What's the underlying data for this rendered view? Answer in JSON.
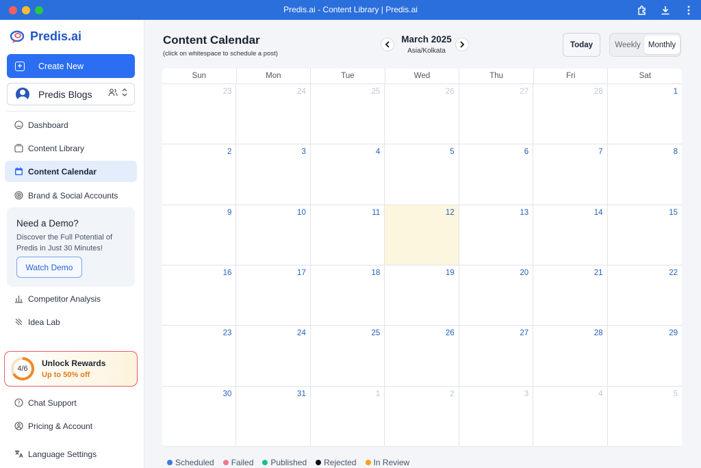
{
  "window": {
    "title": "Predis.ai - Content Library | Predis.ai"
  },
  "sidebar": {
    "brand": "Predis.ai",
    "create_label": "Create New",
    "workspace_name": "Predis Blogs",
    "nav_top": [
      {
        "label": "Dashboard",
        "icon": "dashboard-icon"
      },
      {
        "label": "Content Library",
        "icon": "library-icon"
      },
      {
        "label": "Content Calendar",
        "icon": "calendar-icon",
        "active": true
      },
      {
        "label": "Brand & Social Accounts",
        "icon": "fingerprint-icon"
      }
    ],
    "demo": {
      "title": "Need a Demo?",
      "text": "Discover the Full Potential of Predis in Just 30 Minutes!",
      "button": "Watch Demo"
    },
    "nav_mid": [
      {
        "label": "Competitor Analysis",
        "icon": "bar-chart-icon"
      },
      {
        "label": "Idea Lab",
        "icon": "sparkle-icon"
      }
    ],
    "rewards": {
      "progress": "4/6",
      "progress_fraction": 0.667,
      "title": "Unlock Rewards",
      "subtitle": "Up to 50% off"
    },
    "nav_bottom": [
      {
        "label": "Chat Support",
        "icon": "help-icon"
      },
      {
        "label": "Pricing & Account",
        "icon": "account-icon"
      },
      {
        "label": "Language Settings",
        "icon": "translate-icon"
      }
    ]
  },
  "main": {
    "title": "Content Calendar",
    "subtitle": "(click on whitespace to schedule a post)",
    "month": "March 2025",
    "timezone": "Asia/Kolkata",
    "today_label": "Today",
    "view_weekly": "Weekly",
    "view_monthly": "Monthly",
    "weekdays": [
      "Sun",
      "Mon",
      "Tue",
      "Wed",
      "Thu",
      "Fri",
      "Sat"
    ],
    "weeks": [
      [
        "23",
        "24",
        "25",
        "26",
        "27",
        "28",
        "1"
      ],
      [
        "2",
        "3",
        "4",
        "5",
        "6",
        "7",
        "8"
      ],
      [
        "9",
        "10",
        "11",
        "12",
        "13",
        "14",
        "15"
      ],
      [
        "16",
        "17",
        "18",
        "19",
        "20",
        "21",
        "22"
      ],
      [
        "23",
        "24",
        "25",
        "26",
        "27",
        "28",
        "29"
      ],
      [
        "30",
        "31",
        "1",
        "2",
        "3",
        "4",
        "5"
      ]
    ],
    "today_day": "12",
    "legend": [
      {
        "label": "Scheduled",
        "color": "#3b7ddd"
      },
      {
        "label": "Failed",
        "color": "#f07a8a"
      },
      {
        "label": "Published",
        "color": "#19c08a"
      },
      {
        "label": "Rejected",
        "color": "#111111"
      },
      {
        "label": "In Review",
        "color": "#f2a21b"
      }
    ]
  }
}
